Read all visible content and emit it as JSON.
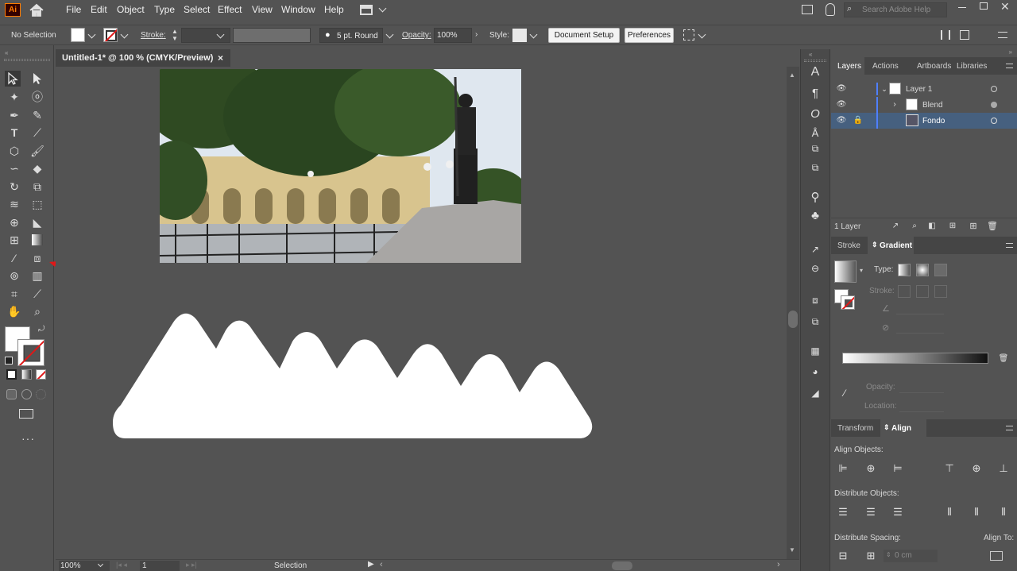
{
  "app": {
    "logo": "Ai"
  },
  "menu": [
    "File",
    "Edit",
    "Object",
    "Type",
    "Select",
    "Effect",
    "View",
    "Window",
    "Help"
  ],
  "search": {
    "placeholder": "Search Adobe Help"
  },
  "control": {
    "selection": "No Selection",
    "stroke_label": "Stroke:",
    "brush": "5 pt. Round",
    "opacity_label": "Opacity:",
    "opacity_value": "100%",
    "style_label": "Style:",
    "document_setup": "Document Setup",
    "preferences": "Preferences"
  },
  "document": {
    "tab_title": "Untitled-1* @ 100 % (CMYK/Preview)",
    "close": "×"
  },
  "status": {
    "zoom": "100%",
    "artboard": "1",
    "tool": "Selection"
  },
  "layers_panel": {
    "tabs": [
      "Layers",
      "Actions",
      "Artboards",
      "Libraries"
    ],
    "rows": [
      {
        "name": "Layer 1",
        "level": 0
      },
      {
        "name": "Blend",
        "level": 1
      },
      {
        "name": "Fondo",
        "level": 1,
        "selected": true
      }
    ],
    "count": "1 Layer"
  },
  "gradient_panel": {
    "tabs": [
      "Stroke",
      "Gradient"
    ],
    "type_label": "Type:",
    "stroke_label": "Stroke:",
    "opacity_label": "Opacity:",
    "location_label": "Location:"
  },
  "align_panel": {
    "tabs": [
      "Transform",
      "Align"
    ],
    "align_objects": "Align Objects:",
    "distribute_objects": "Distribute Objects:",
    "distribute_spacing": "Distribute Spacing:",
    "align_to": "Align To:",
    "spacing_value": "0 cm"
  },
  "colors": {
    "accent": "#ff7c00",
    "selection_row": "#46607f",
    "layer_color": "#4f7fff",
    "annotation_arrow": "#e01818"
  }
}
